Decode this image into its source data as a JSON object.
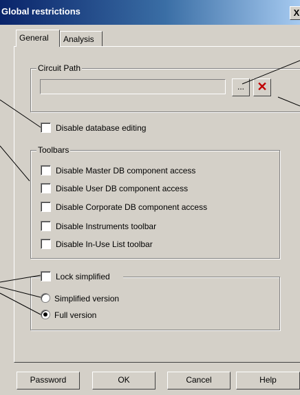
{
  "window": {
    "title": "Global restrictions",
    "close_label": "X"
  },
  "tabs": [
    {
      "label": "General",
      "active": true
    },
    {
      "label": "Analysis",
      "active": false
    }
  ],
  "circuit_path": {
    "group_title": "Circuit Path",
    "value": "",
    "browse_label": "...",
    "clear_icon": "red-x-icon",
    "clear_label": "✕"
  },
  "database": {
    "label": "Disable database editing",
    "checked": false
  },
  "toolbars": {
    "group_title": "Toolbars",
    "items": [
      {
        "label": "Disable Master DB component access",
        "checked": false
      },
      {
        "label": "Disable User DB component access",
        "checked": false
      },
      {
        "label": "Disable Corporate DB component access",
        "checked": false
      },
      {
        "label": "Disable Instruments toolbar",
        "checked": false
      },
      {
        "label": "Disable In-Use List toolbar",
        "checked": false
      }
    ]
  },
  "version": {
    "lock_label": "Lock simplified",
    "lock_checked": false,
    "options": [
      {
        "label": "Simplified version",
        "selected": false
      },
      {
        "label": "Full version",
        "selected": true
      }
    ]
  },
  "buttons": {
    "password": "Password",
    "ok": "OK",
    "cancel": "Cancel",
    "help": "Help"
  },
  "colors": {
    "face": "#d4d0c8",
    "title_start": "#0a246a",
    "title_end": "#a6caf0",
    "clear_x": "#c00000"
  }
}
